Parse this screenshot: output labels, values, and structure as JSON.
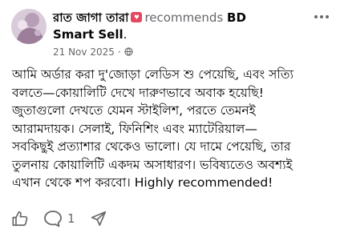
{
  "header": {
    "author": "রাত জাগা তারা",
    "badge_icon": "heart-badge-icon",
    "recommends": "recommends",
    "page_name_part1": "BD",
    "page_name_part2": "Smart Sell",
    "period": ".",
    "date": "21 Nov 2025",
    "separator": "·",
    "privacy_icon": "globe-icon"
  },
  "body": {
    "lines": [
      "আমি অর্ডার করা দু'জোড়া লেডিস শু পেয়েছি, এবং সত্যি",
      "বলতে—কোয়ালিটি দেখে দারুণভাবে অবাক হয়েছি!",
      "জুতাগুলো দেখতে যেমন স্টাইলিশ, পরতে তেমনই",
      "আরামদায়ক। সেলাই, ফিনিশিং এবং ম্যাটেরিয়াল—",
      "সবকিছুই প্রত্যাশার থেকেও ভালো। যে দামে পেয়েছি, তার",
      "তুলনায় কোয়ালিটি একদম অসাধারণ। ভবিষ্যতেও অবশ্যই",
      "এখান থেকে শপ করবো। Highly recommended!"
    ]
  },
  "actions": {
    "like_icon": "thumbs-up-icon",
    "comment_icon": "comment-icon",
    "comment_count": "1",
    "share_icon": "share-icon"
  },
  "colors": {
    "text_primary": "#050505",
    "text_secondary": "#65676b",
    "badge": "#e4455f",
    "background": "#ffffff"
  }
}
